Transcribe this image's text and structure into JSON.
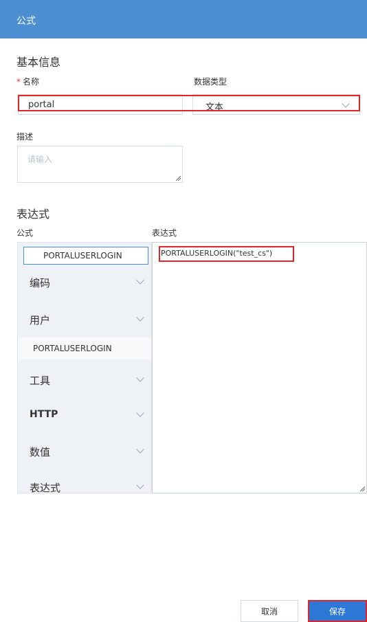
{
  "dialog": {
    "title": "公式"
  },
  "basic": {
    "section_title": "基本信息",
    "name_label": "名称",
    "name_required_mark": "*",
    "name_value": "portal",
    "type_label": "数据类型",
    "type_value": "文本",
    "desc_label": "描述",
    "desc_placeholder": "请输入"
  },
  "expression": {
    "section_title": "表达式",
    "formula_label": "公式",
    "expr_label": "表达式",
    "search_value": "PORTALUSERLOGIN",
    "categories": [
      {
        "label": "编码",
        "expanded": false
      },
      {
        "label": "用户",
        "expanded": true
      },
      {
        "label": "工具",
        "expanded": false
      },
      {
        "label": "HTTP",
        "expanded": false
      },
      {
        "label": "数值",
        "expanded": false
      },
      {
        "label": "表达式",
        "expanded": false
      }
    ],
    "user_sub_item": "PORTALUSERLOGIN",
    "expr_value": "PORTALUSERLOGIN(\"test_cs\")"
  },
  "footer": {
    "cancel_label": "取消",
    "save_label": "保存"
  },
  "colors": {
    "header": "#4b8fd0",
    "highlight": "#e1242a",
    "primary": "#2d78d6"
  },
  "icons": {
    "dropdown": "chevron-down-icon",
    "resize": "resize-grip-icon"
  }
}
